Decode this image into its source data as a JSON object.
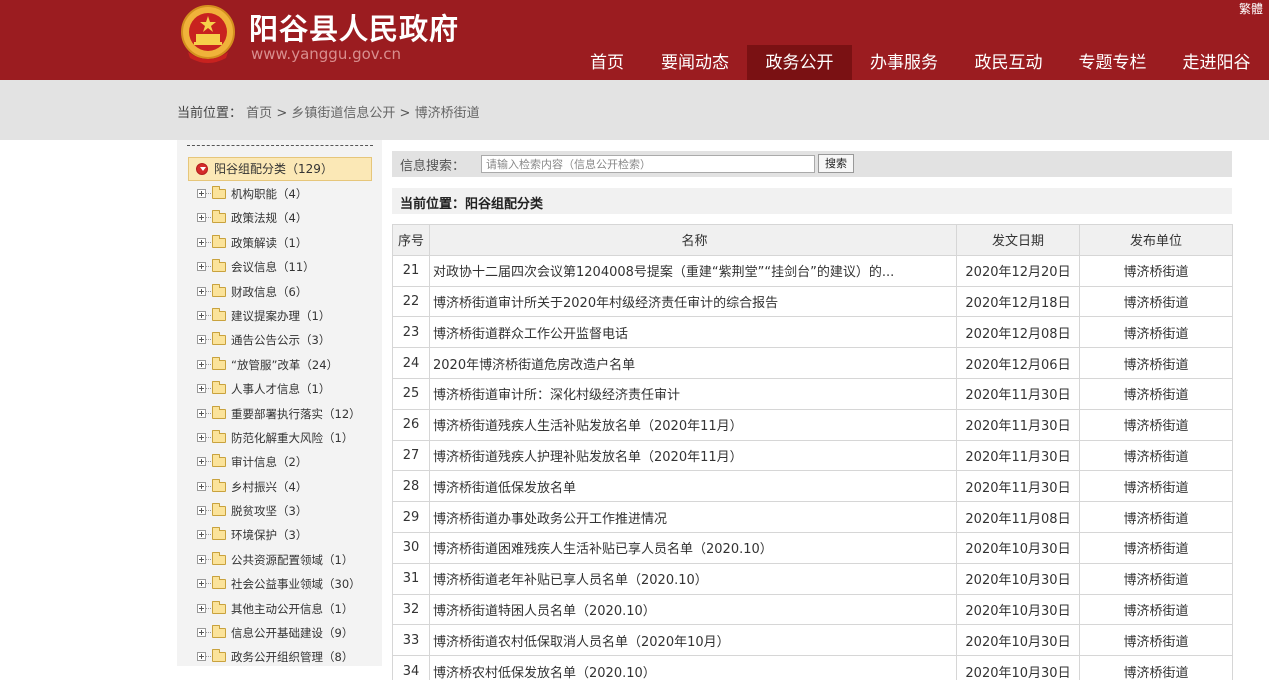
{
  "header": {
    "title": "阳谷县人民政府",
    "url": "www.yanggu.gov.cn",
    "lang_link": "繁體",
    "nav": [
      {
        "label": "首页",
        "active": false
      },
      {
        "label": "要闻动态",
        "active": false
      },
      {
        "label": "政务公开",
        "active": true
      },
      {
        "label": "办事服务",
        "active": false
      },
      {
        "label": "政民互动",
        "active": false
      },
      {
        "label": "专题专栏",
        "active": false
      },
      {
        "label": "走进阳谷",
        "active": false
      }
    ]
  },
  "breadcrumb": {
    "label": "当前位置：",
    "items": [
      "首页",
      "乡镇街道信息公开",
      "博济桥街道"
    ],
    "separator": ">"
  },
  "sidebar": {
    "root": {
      "label": "阳谷组配分类",
      "count": 129
    },
    "items": [
      {
        "label": "机构职能",
        "count": 4
      },
      {
        "label": "政策法规",
        "count": 4
      },
      {
        "label": "政策解读",
        "count": 1
      },
      {
        "label": "会议信息",
        "count": 11
      },
      {
        "label": "财政信息",
        "count": 6
      },
      {
        "label": "建议提案办理",
        "count": 1
      },
      {
        "label": "通告公告公示",
        "count": 3
      },
      {
        "label": "“放管服”改革",
        "count": 24
      },
      {
        "label": "人事人才信息",
        "count": 1
      },
      {
        "label": "重要部署执行落实",
        "count": 12
      },
      {
        "label": "防范化解重大风险",
        "count": 1
      },
      {
        "label": "审计信息",
        "count": 2
      },
      {
        "label": "乡村振兴",
        "count": 4
      },
      {
        "label": "脱贫攻坚",
        "count": 3
      },
      {
        "label": "环境保护",
        "count": 3
      },
      {
        "label": "公共资源配置领域",
        "count": 1
      },
      {
        "label": "社会公益事业领域",
        "count": 30
      },
      {
        "label": "其他主动公开信息",
        "count": 1
      },
      {
        "label": "信息公开基础建设",
        "count": 9
      },
      {
        "label": "政务公开组织管理",
        "count": 8
      }
    ]
  },
  "search": {
    "label": "信息搜索：",
    "placeholder": "请输入检索内容（信息公开检索）",
    "button": "搜索"
  },
  "location": {
    "text": "当前位置：阳谷组配分类"
  },
  "table": {
    "headers": [
      "序号",
      "名称",
      "发文日期",
      "发布单位"
    ],
    "rows": [
      {
        "no": "21",
        "name": "对政协十二届四次会议第1204008号提案（重建“紫荆堂”“挂剑台”的建议）的...",
        "date": "2020年12月20日",
        "unit": "博济桥街道"
      },
      {
        "no": "22",
        "name": "博济桥街道审计所关于2020年村级经济责任审计的综合报告",
        "date": "2020年12月18日",
        "unit": "博济桥街道"
      },
      {
        "no": "23",
        "name": "博济桥街道群众工作公开监督电话",
        "date": "2020年12月08日",
        "unit": "博济桥街道"
      },
      {
        "no": "24",
        "name": "2020年博济桥街道危房改造户名单",
        "date": "2020年12月06日",
        "unit": "博济桥街道"
      },
      {
        "no": "25",
        "name": "博济桥街道审计所：深化村级经济责任审计",
        "date": "2020年11月30日",
        "unit": "博济桥街道"
      },
      {
        "no": "26",
        "name": "博济桥街道残疾人生活补贴发放名单（2020年11月）",
        "date": "2020年11月30日",
        "unit": "博济桥街道"
      },
      {
        "no": "27",
        "name": "博济桥街道残疾人护理补贴发放名单（2020年11月）",
        "date": "2020年11月30日",
        "unit": "博济桥街道"
      },
      {
        "no": "28",
        "name": "博济桥街道低保发放名单",
        "date": "2020年11月30日",
        "unit": "博济桥街道"
      },
      {
        "no": "29",
        "name": "博济桥街道办事处政务公开工作推进情况",
        "date": "2020年11月08日",
        "unit": "博济桥街道"
      },
      {
        "no": "30",
        "name": "博济桥街道困难残疾人生活补贴已享人员名单（2020.10）",
        "date": "2020年10月30日",
        "unit": "博济桥街道"
      },
      {
        "no": "31",
        "name": "博济桥街道老年补贴已享人员名单（2020.10）",
        "date": "2020年10月30日",
        "unit": "博济桥街道"
      },
      {
        "no": "32",
        "name": "博济桥街道特困人员名单（2020.10）",
        "date": "2020年10月30日",
        "unit": "博济桥街道"
      },
      {
        "no": "33",
        "name": "博济桥街道农村低保取消人员名单（2020年10月）",
        "date": "2020年10月30日",
        "unit": "博济桥街道"
      },
      {
        "no": "34",
        "name": "博济桥农村低保发放名单（2020.10）",
        "date": "2020年10月30日",
        "unit": "博济桥街道"
      }
    ]
  },
  "colors": {
    "header_red": "#9b1c20",
    "nav_active": "#7a1113",
    "crumb_bg": "#e3e3e3",
    "sidebar_bg": "#f3f3f3",
    "root_highlight": "#fbe8b6"
  }
}
